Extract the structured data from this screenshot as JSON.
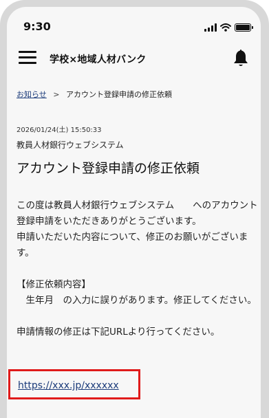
{
  "status_bar": {
    "time": "9:30"
  },
  "header": {
    "app_title": "学校×地域人材バンク"
  },
  "breadcrumb": {
    "parent": "お知らせ",
    "separator": ">",
    "current": "アカウント登録申請の修正依頼"
  },
  "message": {
    "datetime": "2026/01/24(土) 15:50:33",
    "sender": "教員人材銀行ウェブシステム",
    "title": "アカウント登録申請の修正依頼",
    "lines": [
      "この度は教員人材銀行ウェブシステム　　へのアカウント登録申請をいただきありがとうございます。",
      "申請いただいた内容について、修正のお願いがございます。",
      "",
      "【修正依頼内容】",
      "　生年月　の入力に誤りがあります。修正してください。",
      "",
      "申請情報の修正は下記URLより行ってください。"
    ],
    "url": "https://xxx.jp/xxxxxx"
  },
  "colors": {
    "highlight_border": "#e01b1b",
    "link": "#1b3b7a",
    "background": "#f7f7f7"
  },
  "icons": {
    "menu": "hamburger-icon",
    "notifications": "bell-icon"
  }
}
